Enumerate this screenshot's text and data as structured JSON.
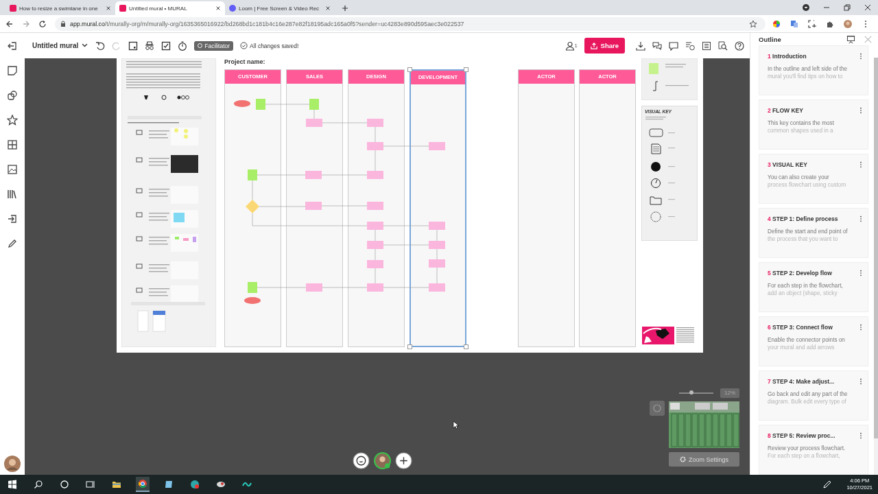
{
  "browser": {
    "tabs": [
      {
        "title": "How to resize a swimlane in one",
        "selected": false
      },
      {
        "title": "Untitled mural • MURAL",
        "selected": true
      },
      {
        "title": "Loom | Free Screen & Video Rec",
        "selected": false
      }
    ],
    "url": {
      "host": "app.mural.co",
      "path": "/t/murally-org/m/murally-org/1635365016922/bd268bd1c181b4c16e287e82f18195adc165a0f5?sender=uc4283e890d595aec3e022537"
    }
  },
  "toolbar": {
    "title": "Untitled mural",
    "facilitator": "Facilitator",
    "save_status": "All changes saved!",
    "collaborators": "1",
    "share": "Share"
  },
  "mural": {
    "project_label": "Project name:",
    "visual_key_title": "VISUAL KEY",
    "swimlane_groups": [
      {
        "lanes": [
          {
            "label": "CUSTOMER",
            "selected": false
          },
          {
            "label": "SALES",
            "selected": false
          },
          {
            "label": "DESIGN",
            "selected": false
          },
          {
            "label": "DEVELOPMENT",
            "selected": true
          }
        ]
      },
      {
        "lanes": [
          {
            "label": "ACTOR",
            "selected": false
          },
          {
            "label": "ACTOR",
            "selected": false
          }
        ]
      }
    ]
  },
  "outline": {
    "title": "Outline",
    "sections": [
      {
        "number": "1",
        "title": "Introduction",
        "lines": [
          "In the outline and left side of the",
          "mural you'll find tips on how to"
        ]
      },
      {
        "number": "2",
        "title": "FLOW KEY",
        "lines": [
          "This key contains the most",
          "common shapes used in a"
        ]
      },
      {
        "number": "3",
        "title": "VISUAL KEY",
        "lines": [
          "You can also create your",
          "process flowchart using custom"
        ]
      },
      {
        "number": "4",
        "title": "STEP 1: Define process",
        "lines": [
          "Define the start and end point of",
          "the process that you want to"
        ]
      },
      {
        "number": "5",
        "title": "STEP 2: Develop flow",
        "lines": [
          "For each step in the flowchart,",
          "add an object (shape, sticky"
        ]
      },
      {
        "number": "6",
        "title": "STEP 3: Connect flow",
        "lines": [
          "Enable the connector points on",
          "your mural and add arrows"
        ]
      },
      {
        "number": "7",
        "title": "STEP 4: Make adjust...",
        "lines": [
          "Go back and edit any part of the",
          "diagram. Bulk edit every type of"
        ]
      },
      {
        "number": "8",
        "title": "STEP 5: Review proc...",
        "lines": [
          "Review your process flowchart.",
          "For each step on a flowchart,"
        ]
      }
    ]
  },
  "zoom": {
    "level": 0.35,
    "level_text": "12%",
    "settings": "Zoom Settings"
  },
  "taskbar": {
    "time": "4:06 PM",
    "date": "10/27/2021"
  }
}
